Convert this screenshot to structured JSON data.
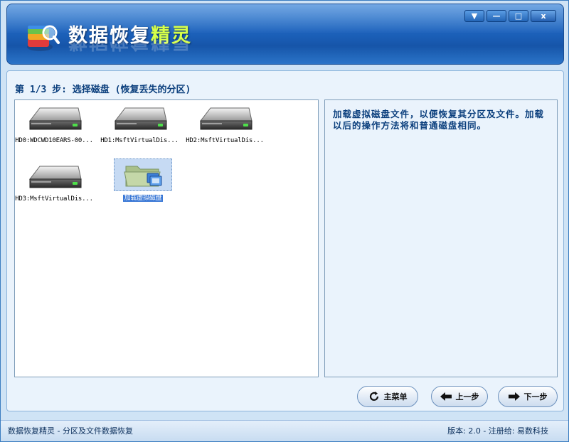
{
  "window": {
    "title_part1": "数据恢复",
    "title_part2": "精灵",
    "controls": {
      "menu_label": "▼",
      "minimize_label": "—",
      "maximize_label": "□",
      "close_label": "x"
    }
  },
  "step": {
    "title": "第 1/3 步: 选择磁盘 (恢复丢失的分区)"
  },
  "disks": [
    {
      "label": "HD0:WDCWD10EARS-00...",
      "type": "disk-icon"
    },
    {
      "label": "HD1:MsftVirtualDis...",
      "type": "disk-icon"
    },
    {
      "label": "HD2:MsftVirtualDis...",
      "type": "disk-icon"
    },
    {
      "label": "HD3:MsftVirtualDis...",
      "type": "disk-icon"
    },
    {
      "label": "加载虚拟磁盘",
      "type": "virtual-disk-folder-icon",
      "selected": true
    }
  ],
  "description": {
    "text": "加载虚拟磁盘文件，以便恢复其分区及文件。加载以后的操作方法将和普通磁盘相同。"
  },
  "buttons": {
    "main_menu": "主菜单",
    "previous": "上一步",
    "next": "下一步"
  },
  "status": {
    "left": "数据恢复精灵 - 分区及文件数据恢复",
    "right": "版本: 2.0 - 注册给: 易数科技"
  },
  "colors": {
    "banner_blue": "#1d63bd",
    "title_accent": "#d6ff4a",
    "selection": "#3a78d6",
    "panel_bg": "#eaf3fc"
  }
}
